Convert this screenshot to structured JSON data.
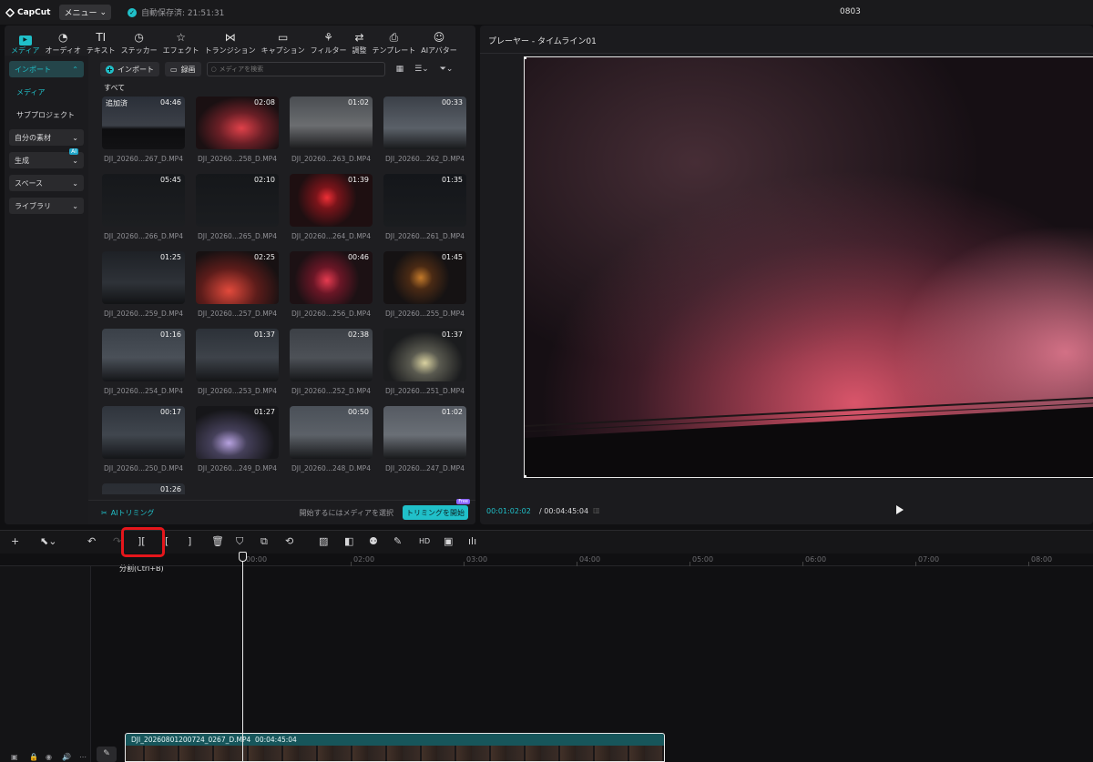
{
  "titlebar": {
    "app_name": "CapCut",
    "menu_label": "メニュー",
    "autosave": "自動保存済: 21:51:31",
    "project_name": "0803"
  },
  "toolbar": {
    "tabs": [
      {
        "label": "メディア",
        "icon": "media-icon"
      },
      {
        "label": "オーディオ",
        "icon": "audio-icon"
      },
      {
        "label": "テキスト",
        "icon": "text-icon"
      },
      {
        "label": "ステッカー",
        "icon": "sticker-icon"
      },
      {
        "label": "エフェクト",
        "icon": "effect-icon"
      },
      {
        "label": "トランジション",
        "icon": "transition-icon"
      },
      {
        "label": "キャプション",
        "icon": "caption-icon"
      },
      {
        "label": "フィルター",
        "icon": "filter-icon"
      },
      {
        "label": "調整",
        "icon": "adjust-icon"
      },
      {
        "label": "テンプレート",
        "icon": "template-icon"
      },
      {
        "label": "AIアバター",
        "icon": "ai-avatar-icon"
      }
    ]
  },
  "sidebar": {
    "items": [
      {
        "label": "インポート"
      },
      {
        "label": "メディア"
      },
      {
        "label": "サブプロジェクト"
      },
      {
        "label": "自分の素材"
      },
      {
        "label": "生成",
        "badge": "AI"
      },
      {
        "label": "スペース"
      },
      {
        "label": "ライブラリ"
      }
    ]
  },
  "media": {
    "import_label": "インポート",
    "record_label": "録画",
    "search_placeholder": "メディアを検索",
    "section_label": "すべて",
    "added_label": "追加済",
    "items": [
      {
        "name": "DJI_20260...267_D.MP4",
        "duration": "04:46"
      },
      {
        "name": "DJI_20260...258_D.MP4",
        "duration": "02:08"
      },
      {
        "name": "DJI_20260...263_D.MP4",
        "duration": "01:02"
      },
      {
        "name": "DJI_20260...262_D.MP4",
        "duration": "00:33"
      },
      {
        "name": "DJI_20260...266_D.MP4",
        "duration": "05:45"
      },
      {
        "name": "DJI_20260...265_D.MP4",
        "duration": "02:10"
      },
      {
        "name": "DJI_20260...264_D.MP4",
        "duration": "01:39"
      },
      {
        "name": "DJI_20260...261_D.MP4",
        "duration": "01:35"
      },
      {
        "name": "DJI_20260...259_D.MP4",
        "duration": "01:25"
      },
      {
        "name": "DJI_20260...257_D.MP4",
        "duration": "02:25"
      },
      {
        "name": "DJI_20260...256_D.MP4",
        "duration": "00:46"
      },
      {
        "name": "DJI_20260...255_D.MP4",
        "duration": "01:45"
      },
      {
        "name": "DJI_20260...254_D.MP4",
        "duration": "01:16"
      },
      {
        "name": "DJI_20260...253_D.MP4",
        "duration": "01:37"
      },
      {
        "name": "DJI_20260...252_D.MP4",
        "duration": "02:38"
      },
      {
        "name": "DJI_20260...251_D.MP4",
        "duration": "01:37"
      },
      {
        "name": "DJI_20260...250_D.MP4",
        "duration": "00:17"
      },
      {
        "name": "DJI_20260...249_D.MP4",
        "duration": "01:27"
      },
      {
        "name": "DJI_20260...248_D.MP4",
        "duration": "00:50"
      },
      {
        "name": "DJI_20260...247_D.MP4",
        "duration": "01:02"
      },
      {
        "name": "",
        "duration": "01:26"
      }
    ]
  },
  "ai_trim": {
    "label": "AIトリミング",
    "hint": "開始するにはメディアを選択",
    "button": "トリミングを開始",
    "badge": "Free"
  },
  "player": {
    "title": "プレーヤー - タイムライン01",
    "current_time": "00:01:02:02",
    "total_time": "00:04:45:04"
  },
  "timeline": {
    "tooltip": "分割(Ctrl+B)",
    "ruler_labels": [
      "00:00",
      "02:00",
      "03:00",
      "04:00",
      "05:00",
      "06:00",
      "07:00",
      "08:00"
    ],
    "clip_name": "DJI_20260801200724_0267_D.MP4",
    "clip_duration": "00:04:45:04"
  }
}
